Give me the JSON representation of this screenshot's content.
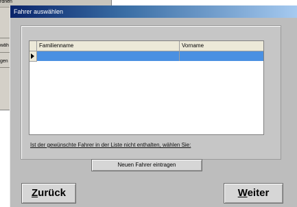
{
  "background_window": {
    "labels": [
      "rdnen",
      "wäh",
      "gen"
    ]
  },
  "dialog": {
    "title": "Fahrer auswählen",
    "table": {
      "columns": [
        "Familienname",
        "Vorname"
      ],
      "rows": [
        {
          "familienname": "",
          "vorname": "",
          "selected": true
        }
      ]
    },
    "hint_text": "Ist der gewünschte Fahrer in der Liste nicht enthalten, wählen Sie:",
    "new_driver_button": {
      "label": "Neuen Fahrer eintragen"
    },
    "back_button": {
      "mnemonic": "Z",
      "rest": "urück"
    },
    "next_button": {
      "mnemonic": "W",
      "rest": "eiter"
    }
  }
}
